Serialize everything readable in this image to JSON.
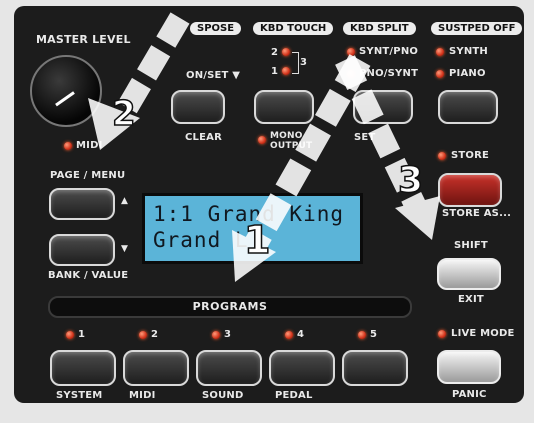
{
  "master_level": {
    "label": "MASTER LEVEL",
    "midi_led_label": "MIDI"
  },
  "transpose": {
    "header": "SPOSE",
    "on_set": "ON/SET ▼",
    "clear": "CLEAR"
  },
  "kbd_touch": {
    "header": "KBD TOUCH",
    "opt_2": "2",
    "opt_1": "1",
    "opt_3": "3",
    "mono_output": "MONO\nOUTPUT"
  },
  "kbd_split": {
    "header": "KBD SPLIT",
    "synt_pno": "SYNT/PNO",
    "pno_synt": "PNO/SYNT",
    "set": "SET"
  },
  "sustped": {
    "header": "SUSTPED OFF",
    "synth": "SYNTH",
    "piano": "PIANO"
  },
  "store": {
    "store_label": "STORE",
    "store_as": "STORE AS..."
  },
  "shift": {
    "label": "SHIFT",
    "exit": "EXIT"
  },
  "page_menu": {
    "label": "PAGE / MENU",
    "up_arrow": "▲",
    "down_arrow": "▼",
    "bank_value": "BANK / VALUE"
  },
  "lcd": {
    "line1": "1:1 Grand King",
    "line2": "Grand L"
  },
  "programs": {
    "label": "PROGRAMS"
  },
  "program_buttons": [
    {
      "number": "1",
      "function": "SYSTEM"
    },
    {
      "number": "2",
      "function": "MIDI"
    },
    {
      "number": "3",
      "function": "SOUND"
    },
    {
      "number": "4",
      "function": "PEDAL"
    },
    {
      "number": "5",
      "function": ""
    }
  ],
  "live_mode": {
    "label": "LIVE MODE",
    "panic": "PANIC"
  },
  "callouts": [
    "1",
    "2",
    "3"
  ],
  "colors": {
    "led": "#e23a1e",
    "lcd": "#5bb4d8",
    "panel": "#1c1c1c",
    "store_button": "#c8322a"
  }
}
